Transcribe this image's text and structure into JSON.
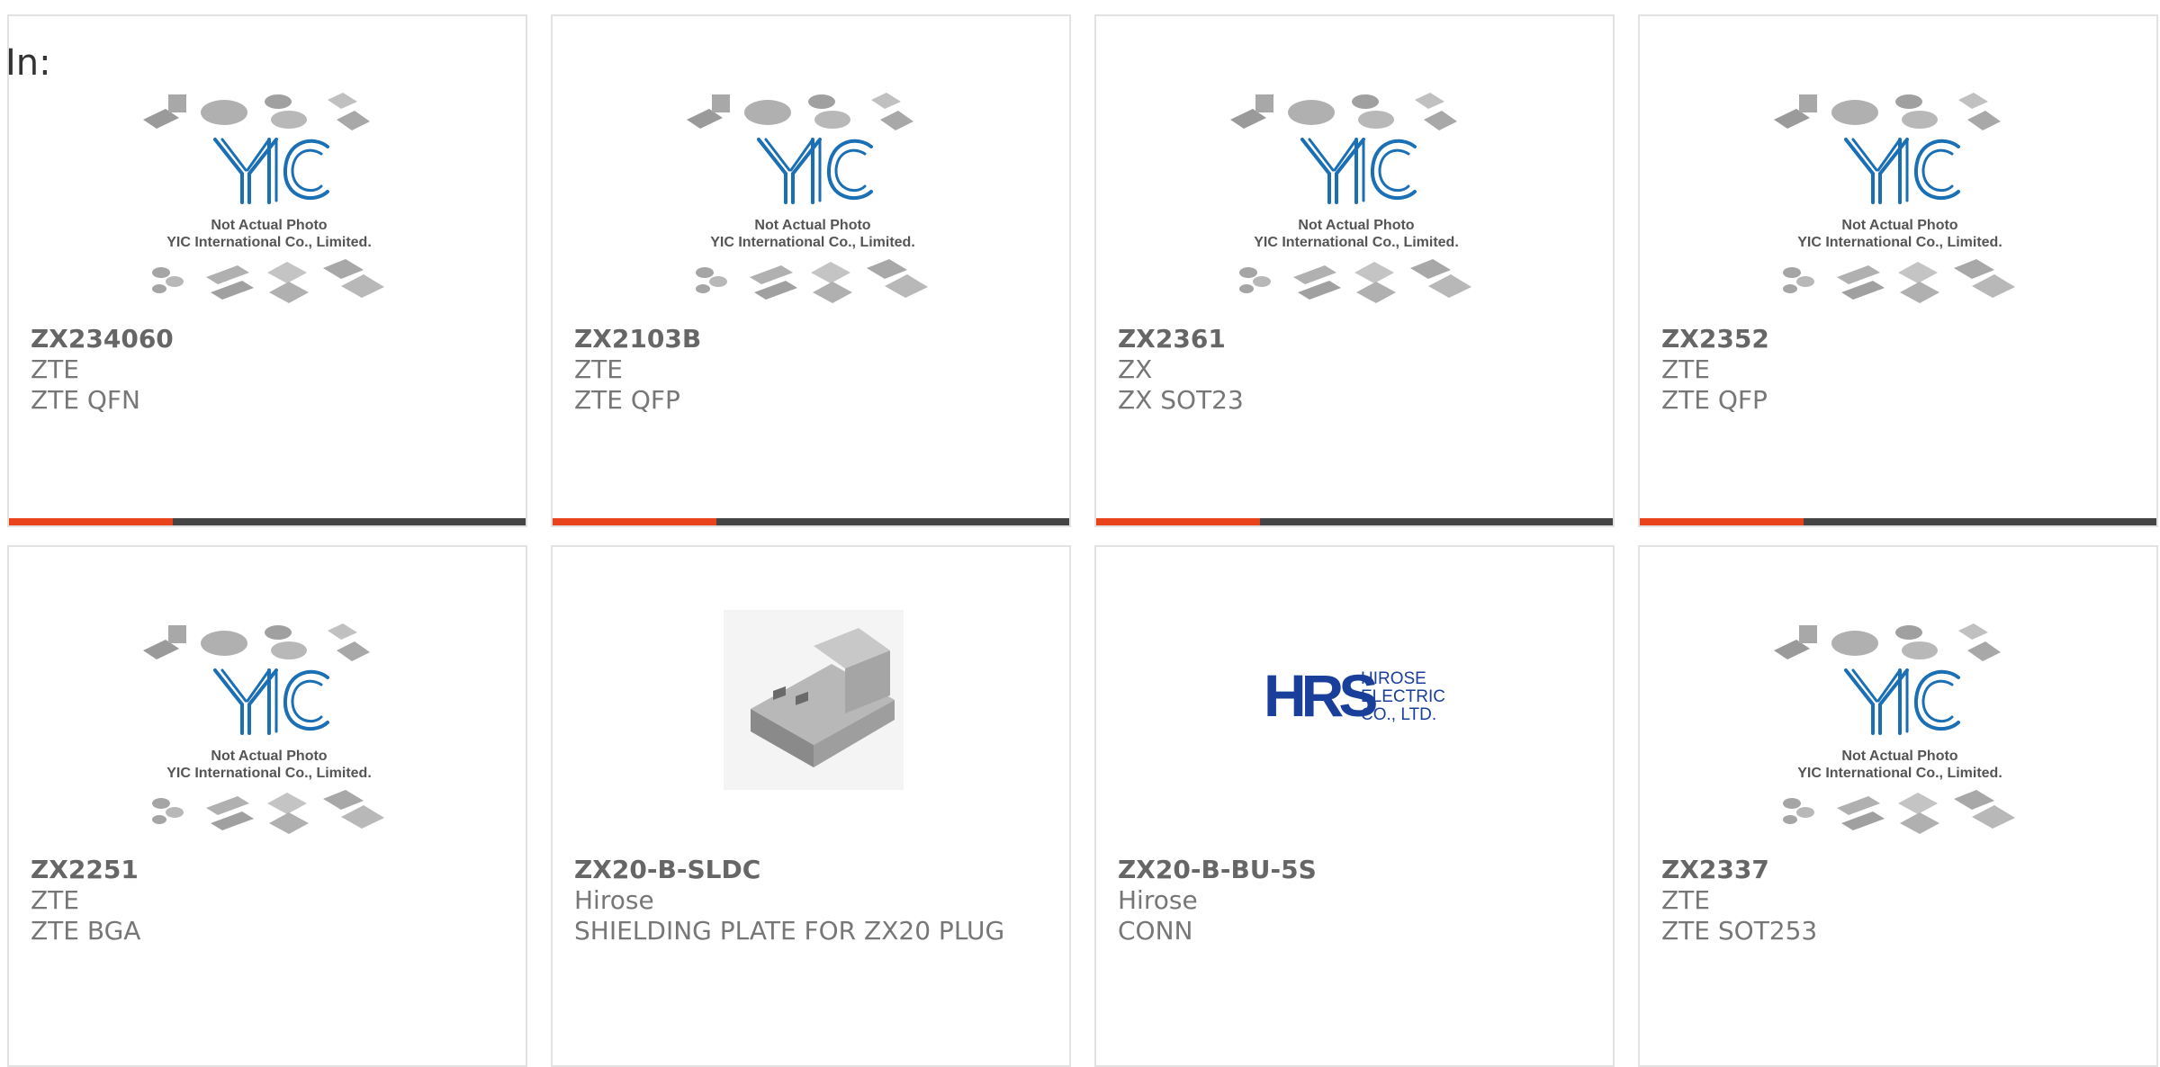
{
  "page": {
    "filter_label": "In:"
  },
  "colors": {
    "accent": "#e8431a",
    "bar": "#444444",
    "yic_blue": "#1a6fb5",
    "hrs_blue": "#1a3f9a"
  },
  "placeholder": {
    "caption_line1": "Not Actual Photo",
    "caption_line2": "YIC International Co., Limited.",
    "logo_text": "YIC"
  },
  "hirose_logo": {
    "mark": "HRS",
    "line1": "HIROSE",
    "line2": "ELECTRIC",
    "line3": "CO., LTD."
  },
  "products": [
    {
      "part": "ZX234060",
      "maker": "ZTE",
      "desc": "ZTE QFN",
      "image": "yic-placeholder-icon",
      "has_bar": true
    },
    {
      "part": "ZX2103B",
      "maker": "ZTE",
      "desc": "ZTE QFP",
      "image": "yic-placeholder-icon",
      "has_bar": true
    },
    {
      "part": "ZX2361",
      "maker": "ZX",
      "desc": "ZX SOT23",
      "image": "yic-placeholder-icon",
      "has_bar": true
    },
    {
      "part": "ZX2352",
      "maker": "ZTE",
      "desc": "ZTE QFP",
      "image": "yic-placeholder-icon",
      "has_bar": true
    },
    {
      "part": "ZX2251",
      "maker": "ZTE",
      "desc": "ZTE BGA",
      "image": "yic-placeholder-icon",
      "has_bar": false
    },
    {
      "part": "ZX20-B-SLDC",
      "maker": "Hirose",
      "desc": "SHIELDING PLATE FOR ZX20 PLUG",
      "image": "shielding-plate-photo",
      "has_bar": false
    },
    {
      "part": "ZX20-B-BU-5S",
      "maker": "Hirose",
      "desc": "CONN",
      "image": "hirose-logo",
      "has_bar": false
    },
    {
      "part": "ZX2337",
      "maker": "ZTE",
      "desc": "ZTE SOT253",
      "image": "yic-placeholder-icon",
      "has_bar": false
    }
  ]
}
